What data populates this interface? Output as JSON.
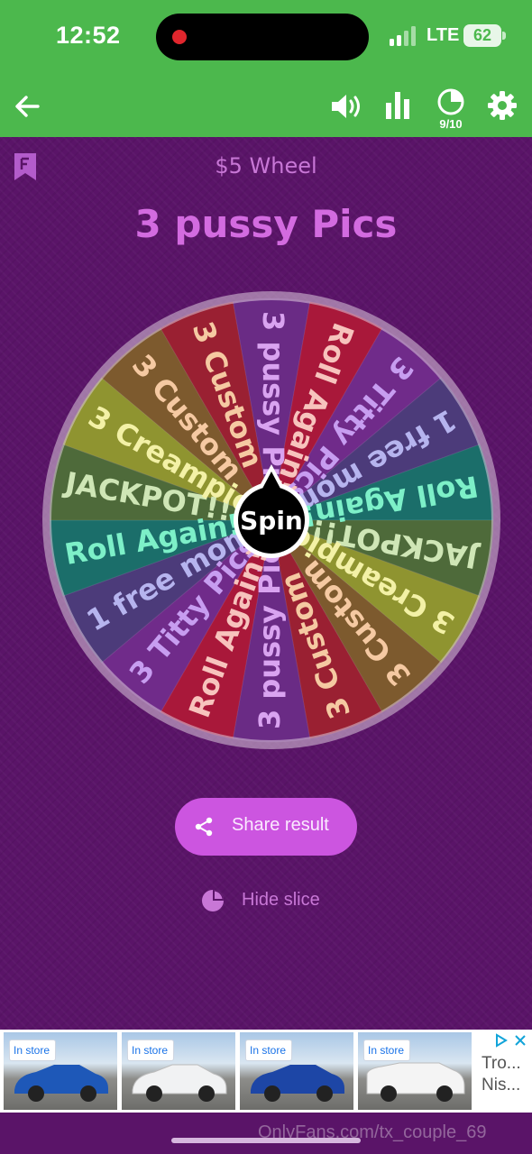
{
  "status_bar": {
    "time": "12:52",
    "network": "LTE",
    "battery": "62"
  },
  "app_bar": {
    "pie_count": "9/10",
    "icons": [
      "back-arrow-icon",
      "volume-icon",
      "bar-chart-icon",
      "pie-chart-icon",
      "gear-icon"
    ]
  },
  "wheel": {
    "subtitle": "$5 Wheel",
    "result": "3 pussy Pics",
    "center_label": "Spin",
    "slices": [
      {
        "label": "3 pussy Pics",
        "color": "#6a2b85"
      },
      {
        "label": "Roll Again!",
        "color": "#a9183a"
      },
      {
        "label": "3 Titty Pics",
        "color": "#702b8a"
      },
      {
        "label": "1 free mom",
        "color": "#4c3b7a"
      },
      {
        "label": "Roll Again!",
        "color": "#1b6e6a"
      },
      {
        "label": "JACKPOT!!!",
        "color": "#4e6a3a"
      },
      {
        "label": "3 Creampie",
        "color": "#8f9430"
      },
      {
        "label": "3 Custom",
        "color": "#7d5a2e"
      },
      {
        "label": "3 Custom",
        "color": "#9a2032"
      },
      {
        "label": "3 pussy Pics",
        "color": "#6a2b85"
      },
      {
        "label": "Roll Again!",
        "color": "#a9183a"
      },
      {
        "label": "3 Titty Pics",
        "color": "#702b8a"
      },
      {
        "label": "1 free mom",
        "color": "#4c3b7a"
      },
      {
        "label": "Roll Again!",
        "color": "#1b6e6a"
      },
      {
        "label": "JACKPOT!!!",
        "color": "#4e6a3a"
      },
      {
        "label": "3 Creampie",
        "color": "#8f9430"
      },
      {
        "label": "3 Custom",
        "color": "#7d5a2e"
      },
      {
        "label": "3 Custom",
        "color": "#9a2032"
      }
    ],
    "text_colors": {
      "3 pussy Pics": "#d9a3f0",
      "Roll Again!": "#f7c3bd",
      "3 Titty Pics": "#c79df0",
      "1 free mom": "#b6b4ee",
      "JACKPOT!!!": "#cfe6b6",
      "3 Creampie": "#f3f1a6",
      "3 Custom": "#f5c9a2"
    },
    "roll_again_text_colors": [
      "#f7c3bd",
      "#7df0c8"
    ]
  },
  "actions": {
    "share_label": "Share result",
    "hide_label": "Hide slice"
  },
  "ad": {
    "badge": "In store",
    "text_line1": "Tro...",
    "text_line2": "Nis...",
    "car_colors": [
      "#1e58b8",
      "#f1f2f3",
      "#1d46a6",
      "#f4f4f4"
    ]
  },
  "watermark": "OnlyFans.com/tx_couple_69",
  "colors": {
    "accent_green": "#4cb84d",
    "background_purple": "#5a1468",
    "share_button": "#cc55e0"
  }
}
